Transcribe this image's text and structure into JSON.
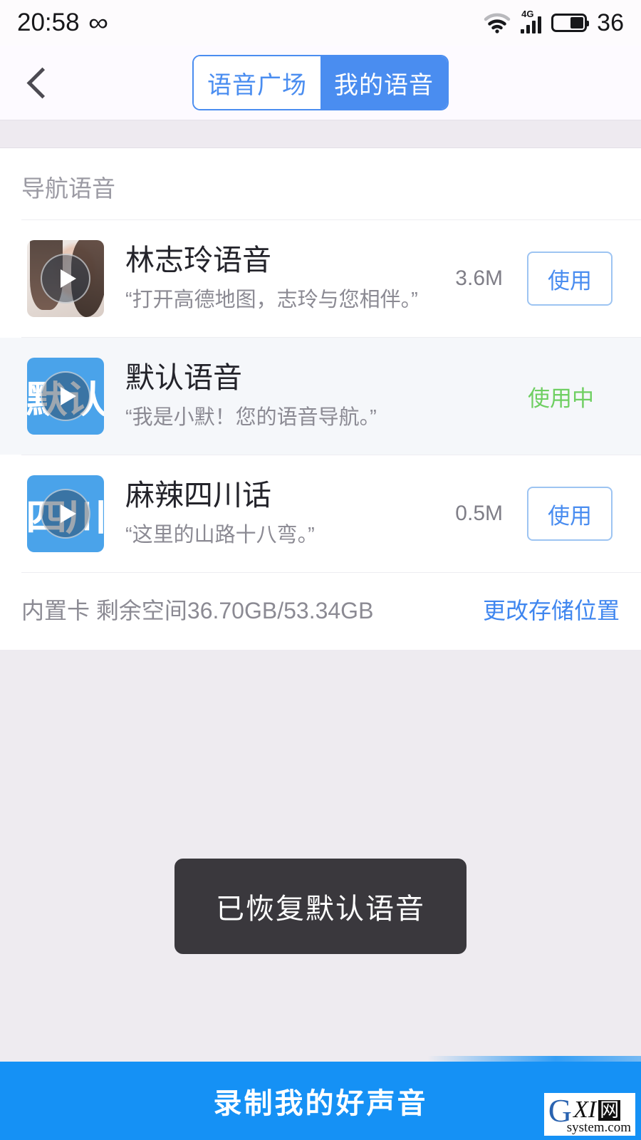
{
  "status_bar": {
    "time": "20:58",
    "infinity_glyph": "∞",
    "battery_percent": "36",
    "network_label": "4G"
  },
  "header": {
    "back_label": "‹",
    "tabs": [
      {
        "label": "语音广场",
        "active": false
      },
      {
        "label": "我的语音",
        "active": true
      }
    ]
  },
  "main": {
    "section_title": "导航语音",
    "voices": [
      {
        "name": "林志玲语音",
        "quote": "“打开高德地图，志玲与您相伴。”",
        "size": "3.6M",
        "action_label": "使用",
        "in_use": false,
        "thumb_type": "photo",
        "thumb_text": ""
      },
      {
        "name": "默认语音",
        "quote": "“我是小默！您的语音导航。”",
        "size": "",
        "action_label": "使用中",
        "in_use": true,
        "thumb_type": "glyph",
        "thumb_text": "默认"
      },
      {
        "name": "麻辣四川话",
        "quote": "“这里的山路十八弯。”",
        "size": "0.5M",
        "action_label": "使用",
        "in_use": false,
        "thumb_type": "glyph",
        "thumb_text": "四川"
      }
    ],
    "storage_text": "内置卡 剩余空间36.70GB/53.34GB",
    "storage_link": "更改存储位置"
  },
  "toast": {
    "message": "已恢复默认语音"
  },
  "bottom_bar": {
    "label": "录制我的好声音"
  },
  "watermark": {
    "g": "G",
    "xi": "XI",
    "net": "网",
    "domain": "system.com"
  },
  "colors": {
    "accent_blue": "#4a8df0",
    "bottom_blue": "#1591f5",
    "in_use_green": "#6fcf62",
    "link_blue": "#3f86ef",
    "page_bg": "#eeebf0"
  }
}
